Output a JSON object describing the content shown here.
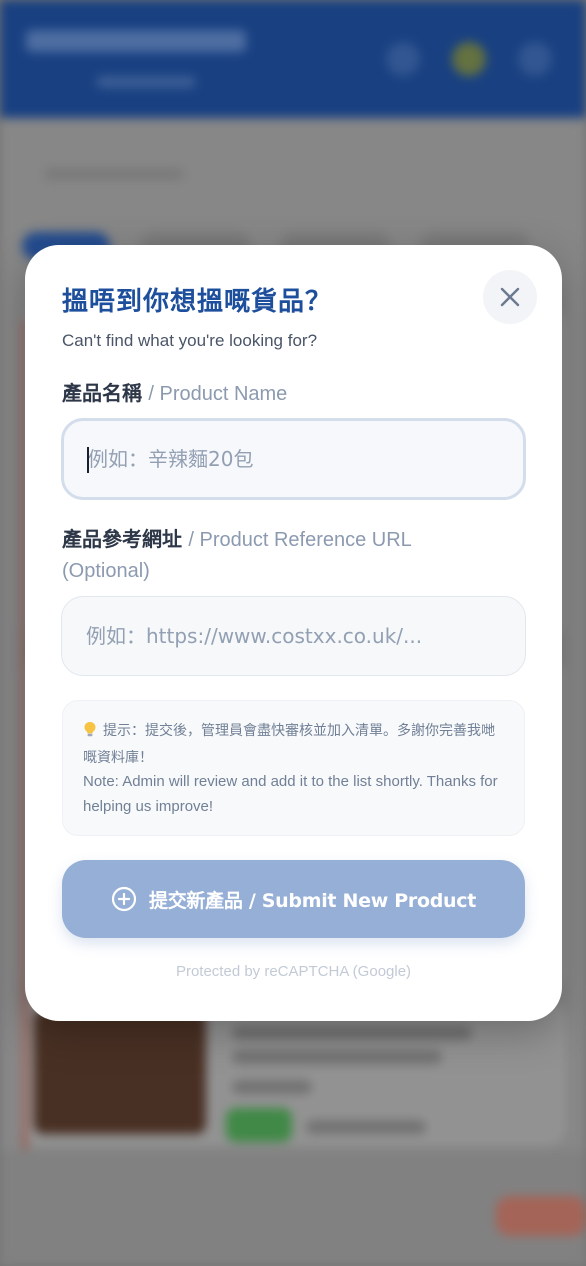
{
  "modal": {
    "title": "搵唔到你想搵嘅貨品？",
    "subtitle": "Can't find what you're looking for?",
    "close_icon": "close-icon",
    "product_name": {
      "label_zh": "產品名稱",
      "label_en": "/ Product Name",
      "placeholder": "例如：辛辣麵20包",
      "value": ""
    },
    "product_url": {
      "label_zh": "產品參考網址",
      "label_en": "/ Product Reference URL (Optional)",
      "placeholder": "例如：https://www.costxx.co.uk/...",
      "value": ""
    },
    "hint": {
      "icon": "lightbulb-icon",
      "text_zh": "提示：提交後，管理員會盡快審核並加入清單。多謝你完善我哋嘅資料庫！",
      "text_en": "Note: Admin will review and add it to the list shortly. Thanks for helping us improve!"
    },
    "submit": {
      "icon": "plus-circle-icon",
      "label": "提交新產品 / Submit New Product"
    },
    "recaptcha_note": "Protected by reCAPTCHA (Google)"
  },
  "colors": {
    "title": "#1d4f9c",
    "submit_bg": "#95afd6",
    "header_bg": "#1f4f9e"
  }
}
